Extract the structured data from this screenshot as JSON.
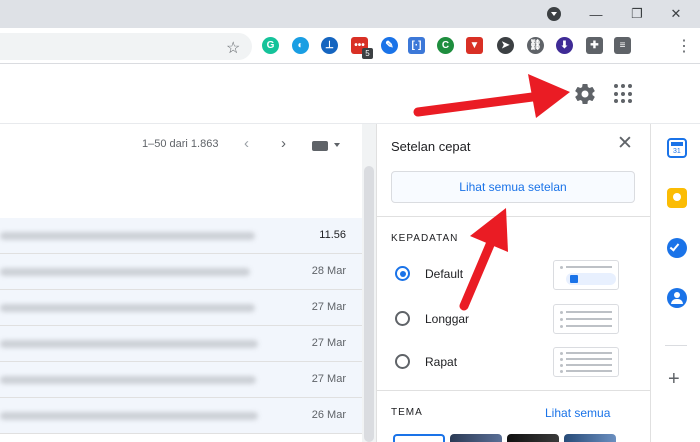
{
  "window": {
    "minimize_glyph": "—",
    "restore_glyph": "❐",
    "close_glyph": "✕"
  },
  "toolbar": {
    "bookmark_icon": "star-icon",
    "star_glyph": "☆",
    "menu_glyph": "⋮",
    "extensions": [
      {
        "name": "grammarly-extension-icon",
        "glyph": "G",
        "color": "#15c39a",
        "shape": "round"
      },
      {
        "name": "droplet-extension-icon",
        "glyph": "◐",
        "color": "#1a9ee3",
        "shape": "round"
      },
      {
        "name": "stamp-extension-icon",
        "glyph": "⊥",
        "color": "#1565c0",
        "shape": "round"
      },
      {
        "name": "badge-extension-icon",
        "glyph": "•••",
        "color": "#d93025",
        "shape": "square"
      },
      {
        "name": "pen-extension-icon",
        "glyph": "✎",
        "color": "#1a73e8",
        "shape": "round"
      },
      {
        "name": "brackets-extension-icon",
        "glyph": "[·]",
        "color": "#3c78d8",
        "shape": "square"
      },
      {
        "name": "c-extension-icon",
        "glyph": "C",
        "color": "#1e8e3e",
        "shape": "round"
      },
      {
        "name": "shield-extension-icon",
        "glyph": "▼",
        "color": "#d93025",
        "shape": "square"
      },
      {
        "name": "cursor-extension-icon",
        "glyph": "➤",
        "color": "#3c4043",
        "shape": "round"
      },
      {
        "name": "link-extension-icon",
        "glyph": "⛓",
        "color": "#5f6368",
        "shape": "round"
      },
      {
        "name": "download-extension-icon",
        "glyph": "⬇",
        "color": "#3f2b96",
        "shape": "round"
      },
      {
        "name": "puzzle-extension-icon",
        "glyph": "✚",
        "color": "#5f6368",
        "shape": "square"
      },
      {
        "name": "playlist-extension-icon",
        "glyph": "≡",
        "color": "#5f6368",
        "shape": "square"
      }
    ],
    "badge_count": "5"
  },
  "header": {
    "settings_icon": "gear-icon",
    "apps_icon": "apps-grid-icon"
  },
  "mail_list": {
    "pagination": "1–50 dari 1.863",
    "prev_glyph": "‹",
    "next_glyph": "›",
    "rows": [
      {
        "date": "11.56",
        "unread": true
      },
      {
        "date": "28 Mar",
        "unread": false
      },
      {
        "date": "27 Mar",
        "unread": false
      },
      {
        "date": "27 Mar",
        "unread": false
      },
      {
        "date": "27 Mar",
        "unread": false
      },
      {
        "date": "26 Mar",
        "unread": false
      }
    ]
  },
  "quick_settings": {
    "title": "Setelan cepat",
    "close_glyph": "✕",
    "see_all_settings": "Lihat semua setelan",
    "density_label": "KEPADATAN",
    "density_options": [
      {
        "label": "Default",
        "selected": true
      },
      {
        "label": "Longgar",
        "selected": false
      },
      {
        "label": "Rapat",
        "selected": false
      }
    ],
    "theme_label": "TEMA",
    "theme_see_all": "Lihat semua"
  },
  "side_panel": {
    "add_glyph": "+"
  },
  "colors": {
    "accent": "#1a73e8",
    "arrow": "#ea1c24"
  }
}
